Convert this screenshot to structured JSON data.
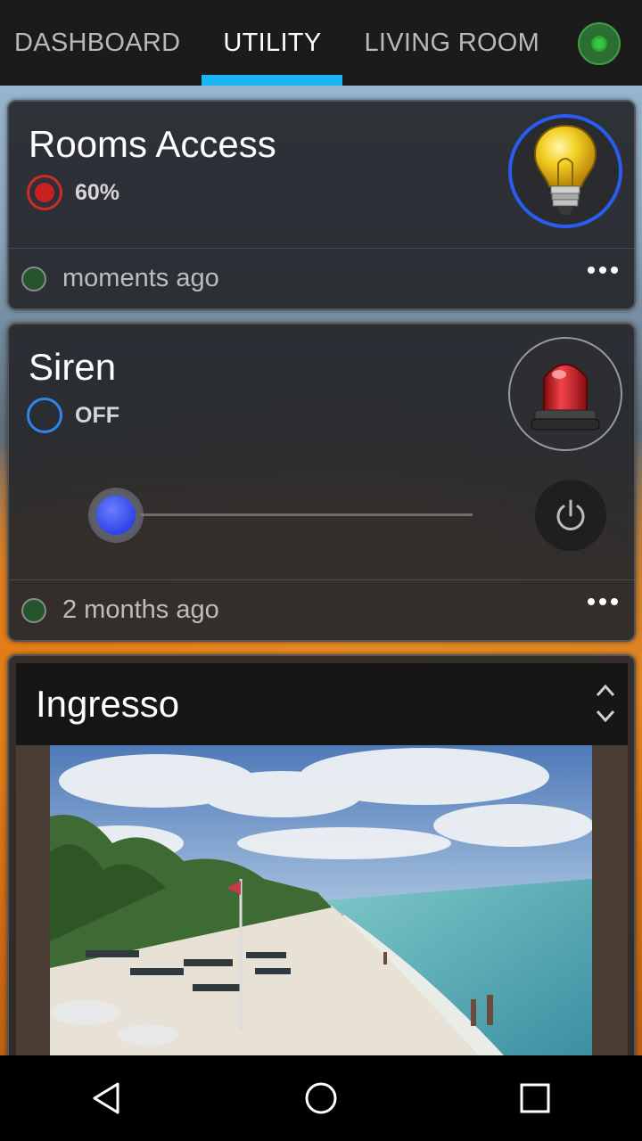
{
  "tabs": [
    {
      "label": "DASHBOARD",
      "active": false
    },
    {
      "label": "UTILITY",
      "active": true
    },
    {
      "label": "LIVING ROOM",
      "active": false
    }
  ],
  "connection_status_icon": "status-dot-icon",
  "cards": {
    "rooms_access": {
      "title": "Rooms Access",
      "state": "60%",
      "last_update": "moments ago",
      "icon": "lightbulb-icon",
      "accent_color": "#2a5cf0"
    },
    "siren": {
      "title": "Siren",
      "state": "OFF",
      "last_update": "2 months ago",
      "icon": "siren-icon",
      "slider_level": 0
    },
    "ingresso": {
      "title": "Ingresso",
      "icon": "camera-feed"
    }
  },
  "colors": {
    "tab_indicator": "#19b6f2",
    "status_red": "#d22a2a",
    "status_blue": "#2f86ea",
    "slider_thumb": "#2f44e6"
  },
  "navbar": {
    "back": "back-icon",
    "home": "home-icon",
    "recents": "recents-icon"
  }
}
